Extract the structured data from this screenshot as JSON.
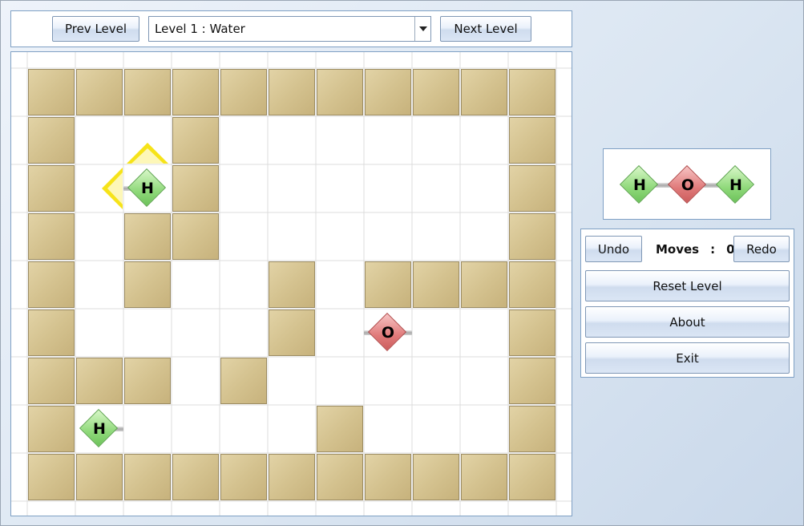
{
  "toolbar": {
    "prev_label": "Prev Level",
    "next_label": "Next Level",
    "level_selected": "Level 1 : Water"
  },
  "board": {
    "cols": 11,
    "rows": 9,
    "walls": [
      [
        0,
        0
      ],
      [
        0,
        1
      ],
      [
        0,
        2
      ],
      [
        0,
        3
      ],
      [
        0,
        4
      ],
      [
        0,
        5
      ],
      [
        0,
        6
      ],
      [
        0,
        7
      ],
      [
        0,
        8
      ],
      [
        0,
        9
      ],
      [
        0,
        10
      ],
      [
        1,
        0
      ],
      [
        1,
        3
      ],
      [
        1,
        10
      ],
      [
        2,
        0
      ],
      [
        2,
        3
      ],
      [
        2,
        10
      ],
      [
        3,
        0
      ],
      [
        3,
        2
      ],
      [
        3,
        3
      ],
      [
        3,
        10
      ],
      [
        4,
        0
      ],
      [
        4,
        2
      ],
      [
        4,
        5
      ],
      [
        4,
        7
      ],
      [
        4,
        8
      ],
      [
        4,
        9
      ],
      [
        4,
        10
      ],
      [
        5,
        0
      ],
      [
        5,
        5
      ],
      [
        5,
        10
      ],
      [
        6,
        0
      ],
      [
        6,
        1
      ],
      [
        6,
        2
      ],
      [
        6,
        4
      ],
      [
        6,
        10
      ],
      [
        7,
        0
      ],
      [
        7,
        6
      ],
      [
        7,
        10
      ],
      [
        8,
        0
      ],
      [
        8,
        1
      ],
      [
        8,
        2
      ],
      [
        8,
        3
      ],
      [
        8,
        4
      ],
      [
        8,
        5
      ],
      [
        8,
        6
      ],
      [
        8,
        7
      ],
      [
        8,
        8
      ],
      [
        8,
        9
      ],
      [
        8,
        10
      ]
    ],
    "atoms": [
      {
        "symbol": "H",
        "row": 2,
        "col": 2,
        "bonds": [
          "left"
        ],
        "selected": true,
        "arrows": [
          "up",
          "left"
        ]
      },
      {
        "symbol": "O",
        "row": 5,
        "col": 7,
        "bonds": [
          "left",
          "right"
        ]
      },
      {
        "symbol": "H",
        "row": 7,
        "col": 1,
        "bonds": [
          "right"
        ]
      }
    ],
    "colors": {
      "H": "#7fd16a",
      "O": "#d96565",
      "wall": "#d4c28f",
      "arrow": "#f5e000"
    }
  },
  "goal": {
    "molecule": [
      "H",
      "O",
      "H"
    ]
  },
  "controls": {
    "undo_label": "Undo",
    "redo_label": "Redo",
    "moves_label": "Moves",
    "moves_sep": ":",
    "moves_value": "0",
    "reset_label": "Reset Level",
    "about_label": "About",
    "exit_label": "Exit"
  }
}
